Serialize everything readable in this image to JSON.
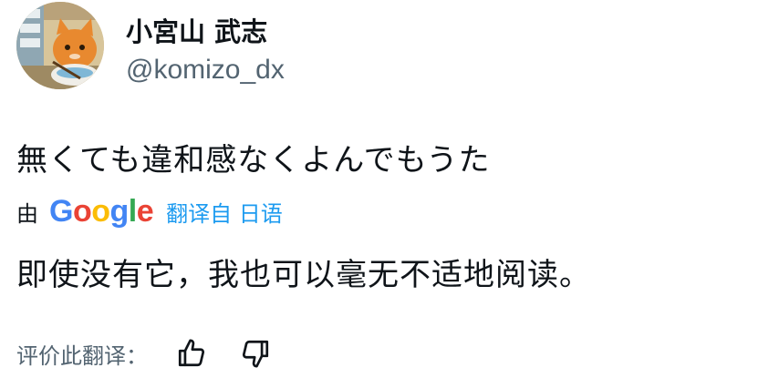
{
  "author": {
    "display_name": "小宮山 武志",
    "handle": "@komizo_dx",
    "avatar_icon": "cartoon-cat-avatar"
  },
  "tweet": {
    "original_text": "無くても違和感なくよんでもうた"
  },
  "translation": {
    "by_label": "由",
    "provider": "Google",
    "translated_from": "翻译自 日语",
    "text": "即使没有它，我也可以毫无不适地阅读。",
    "link_color": "#1d9bf0"
  },
  "rating": {
    "label": "评价此翻译：",
    "thumbs_up_icon": "thumbs-up-icon",
    "thumbs_down_icon": "thumbs-down-icon"
  }
}
